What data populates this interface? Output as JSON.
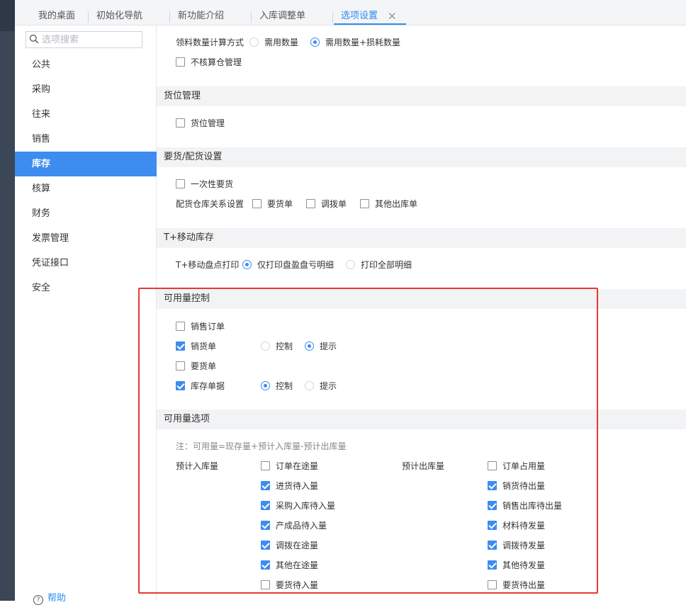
{
  "tabs": [
    {
      "label": "我的桌面"
    },
    {
      "label": "初始化导航"
    },
    {
      "label": "新功能介绍"
    },
    {
      "label": "入库调整单"
    },
    {
      "label": "选项设置"
    }
  ],
  "sidebar": {
    "search_placeholder": "选项搜索",
    "items": [
      {
        "label": "公共"
      },
      {
        "label": "采购"
      },
      {
        "label": "往来"
      },
      {
        "label": "销售"
      },
      {
        "label": "库存"
      },
      {
        "label": "核算"
      },
      {
        "label": "财务"
      },
      {
        "label": "发票管理"
      },
      {
        "label": "凭证接口"
      },
      {
        "label": "安全"
      }
    ],
    "active": "库存",
    "help": "帮助"
  },
  "main": {
    "top": {
      "calc_label": "领料数量计算方式",
      "calc_options": [
        {
          "label": "需用数量",
          "selected": false
        },
        {
          "label": "需用数量+损耗数量",
          "selected": true
        }
      ],
      "no_check_warehouse": {
        "label": "不核算仓管理",
        "checked": false
      }
    },
    "location": {
      "title": "货位管理",
      "enable": {
        "label": "货位管理",
        "checked": false
      }
    },
    "requisition": {
      "title": "要货/配货设置",
      "one_time": {
        "label": "一次性要货",
        "checked": false
      },
      "relation_label": "配货仓库关系设置",
      "relation_options": [
        {
          "label": "要货单",
          "checked": false
        },
        {
          "label": "调拨单",
          "checked": false
        },
        {
          "label": "其他出库单",
          "checked": false
        }
      ]
    },
    "mobile": {
      "title": "T+移动库存",
      "print_label": "T+移动盘点打印",
      "print_options": [
        {
          "label": "仅打印盘盈盘亏明细",
          "selected": true
        },
        {
          "label": "打印全部明细",
          "selected": false
        }
      ]
    },
    "available_control": {
      "title": "可用量控制",
      "rows": [
        {
          "label": "销售订单",
          "checked": false,
          "mode": null
        },
        {
          "label": "销货单",
          "checked": true,
          "mode": "提示"
        },
        {
          "label": "要货单",
          "checked": false,
          "mode": null
        },
        {
          "label": "库存单据",
          "checked": true,
          "mode": "控制"
        }
      ],
      "mode_options": [
        "控制",
        "提示"
      ]
    },
    "available_options": {
      "title": "可用量选项",
      "note": "注：可用量=现存量+预计入库量-预计出库量",
      "inbound_label": "预计入库量",
      "outbound_label": "预计出库量",
      "inbound": [
        {
          "label": "订单在途量",
          "checked": false
        },
        {
          "label": "进货待入量",
          "checked": true
        },
        {
          "label": "采购入库待入量",
          "checked": true
        },
        {
          "label": "产成品待入量",
          "checked": true
        },
        {
          "label": "调拨在途量",
          "checked": true
        },
        {
          "label": "其他在途量",
          "checked": true
        },
        {
          "label": "要货待入量",
          "checked": false
        }
      ],
      "outbound": [
        {
          "label": "订单占用量",
          "checked": false
        },
        {
          "label": "销货待出量",
          "checked": true
        },
        {
          "label": "销售出库待出量",
          "checked": true
        },
        {
          "label": "材料待发量",
          "checked": true
        },
        {
          "label": "调拨待发量",
          "checked": true
        },
        {
          "label": "其他待发量",
          "checked": true
        },
        {
          "label": "要货待出量",
          "checked": false
        }
      ]
    }
  },
  "colors": {
    "accent": "#3d8cf0",
    "highlight": "#e53935"
  }
}
